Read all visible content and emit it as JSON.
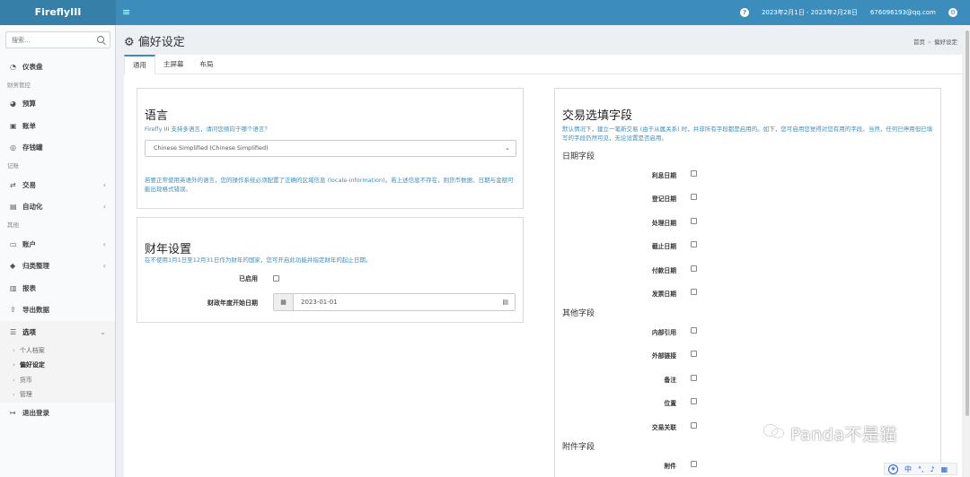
{
  "app": {
    "logo": "FireflyIII"
  },
  "topbar": {
    "menu_glyph": "≡",
    "help_glyph": "?",
    "date_range": "2023年2月1日 - 2023年2月28日",
    "user_email": "676096193@qq.com",
    "settings_glyph": "⚙"
  },
  "sidebar": {
    "search_placeholder": "搜索...",
    "dashboard": "仪表盘",
    "header_finance": "财务管控",
    "budgets": "预算",
    "bills": "账单",
    "piggy": "存钱罐",
    "header_records": "记账",
    "transactions": "交易",
    "automation": "自动化",
    "header_others": "其他",
    "accounts": "账户",
    "classification": "归类整理",
    "reports": "报表",
    "export": "导出数据",
    "options": "选项",
    "sub_profile": "个人档案",
    "sub_preferences": "偏好设定",
    "sub_currency": "货币",
    "sub_admin": "管理",
    "logout": "退出登录"
  },
  "page": {
    "title": "偏好设定",
    "breadcrumb_home": "首页",
    "breadcrumb_sep": "»",
    "breadcrumb_current": "偏好设定"
  },
  "tabs": [
    "通用",
    "主屏幕",
    "布局"
  ],
  "language_box": {
    "title": "语言",
    "help": "Firefly III 支持多语言，请问您倾向于哪个语言？",
    "selected": "Chinese Simplified (Chinese Simplified)",
    "note": "若要正常使用英语外的语言，您的操作系统必须配置了正确的区域信息 (locale-information)。若上述信息不存在，则货币数据、日期与金额可能出现格式错误。"
  },
  "fiscal_box": {
    "title": "财年设置",
    "help": "在不使用1月1日至12月31日作为财年的国家，您可开启此功能并指定财年的起止日期。",
    "enabled_label": "已启用",
    "start_label": "财政年度开始日期",
    "start_value": "2023-01-01"
  },
  "optional_fields_box": {
    "title": "交易选填字段",
    "help": "默认情况下，建立一笔新交易 (由于从属关系) 时，并非所有字段都是启用的。如下，您可启用您觉得对您有用的字段。当然，任何已停用但已填写的字段仍然可见，无论设置是否启用。",
    "date_header": "日期字段",
    "date_fields": [
      "利息日期",
      "登记日期",
      "处理日期",
      "截止日期",
      "付款日期",
      "发票日期"
    ],
    "other_header": "其他字段",
    "other_fields": [
      "内部引用",
      "外部链接",
      "备注",
      "位置",
      "交易关联"
    ],
    "attach_header": "附件字段",
    "attach_fields": [
      "附件"
    ]
  },
  "watermark": {
    "text": "Panda不是猫"
  },
  "ime": {
    "label": "中"
  },
  "colors": {
    "topbar": "#3c8dbc",
    "logo_bg": "#367fa9",
    "accent": "#3c8dbc"
  }
}
